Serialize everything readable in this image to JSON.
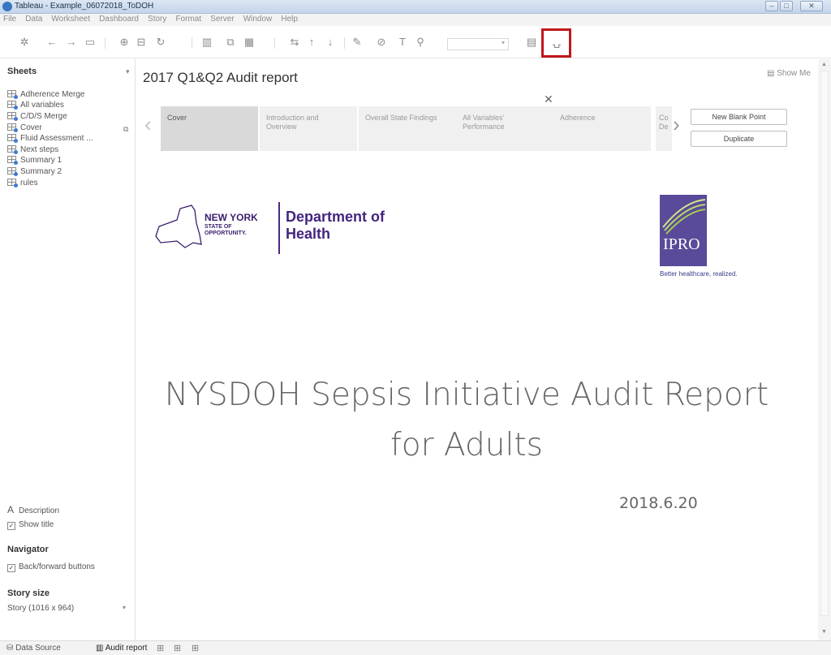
{
  "window": {
    "title": "Tableau - Example_06072018_ToDOH"
  },
  "menu": [
    "File",
    "Data",
    "Worksheet",
    "Dashboard",
    "Story",
    "Format",
    "Server",
    "Window",
    "Help"
  ],
  "toolbar": {
    "show_me": "Show Me",
    "highlighted_tool": "presentation-mode"
  },
  "sidebar": {
    "sheets_heading": "Sheets",
    "sheets": [
      "Adherence Merge",
      "All variables",
      "C/D/S Merge",
      "Cover",
      "Fluid Assessment ...",
      "Next steps",
      "Summary 1",
      "Summary 2",
      "rules"
    ],
    "description_label": "Description",
    "show_title": "Show title",
    "navigator_heading": "Navigator",
    "back_forward": "Back/forward buttons",
    "story_size_heading": "Story size",
    "story_size_value": "Story (1016 x 964)"
  },
  "story": {
    "title": "2017 Q1&Q2 Audit report",
    "points": [
      "Cover",
      "Introduction and Overview",
      "Overall State Findings",
      "All Variables' Performance",
      "Adherence",
      "Co De"
    ],
    "active_point": "Cover",
    "new_blank_point": "New Blank Point",
    "duplicate": "Duplicate"
  },
  "content": {
    "nys_name": "NEW YORK",
    "nys_sub": "STATE OF OPPORTUNITY.",
    "doh": "Department of Health",
    "ipro": "IPRO",
    "ipro_tagline": "Better healthcare, realized.",
    "headline": "NYSDOH Sepsis Initiative Audit Report for Adults",
    "date": "2018.6.20"
  },
  "tabs": {
    "data_source": "Data Source",
    "audit_report": "Audit report"
  },
  "colors": {
    "highlight": "#c0171b",
    "doh_purple": "#43247f",
    "ipro_purple": "#5a4a99"
  }
}
